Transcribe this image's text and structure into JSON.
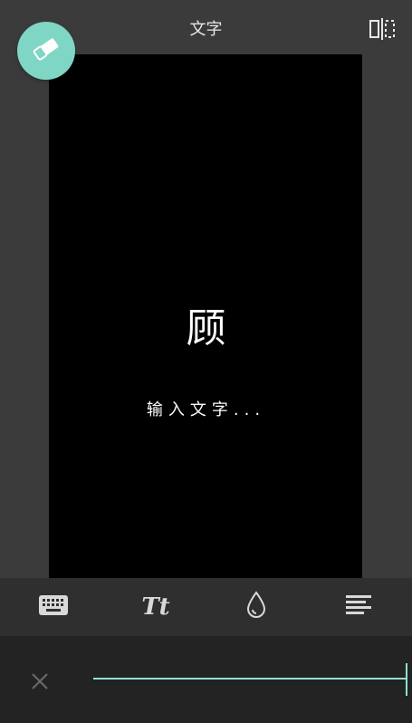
{
  "header": {
    "title": "文字"
  },
  "canvas": {
    "main_char": "顾",
    "placeholder": "输入文字..."
  },
  "toolbar": {
    "font_label": "Tt",
    "tools": [
      "keyboard-icon",
      "font-icon",
      "color-drop-icon",
      "align-icon"
    ]
  },
  "colors": {
    "accent": "#7fd6c5",
    "line": "#8fe0d3",
    "background": "#3b3b3b",
    "canvas": "#000000"
  }
}
